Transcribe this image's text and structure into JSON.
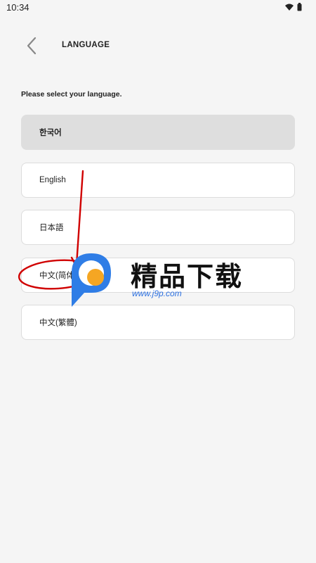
{
  "status_bar": {
    "time": "10:34"
  },
  "header": {
    "title": "LANGUAGE"
  },
  "prompt": "Please select your language.",
  "languages": [
    {
      "label": "한국어",
      "selected": true
    },
    {
      "label": "English",
      "selected": false
    },
    {
      "label": "日本語",
      "selected": false
    },
    {
      "label": "中文(简体)",
      "selected": false
    },
    {
      "label": "中文(繁體)",
      "selected": false
    }
  ],
  "watermark": {
    "text": "精品下载",
    "url": "www.j9p.com"
  },
  "icons": [
    "wifi-icon",
    "battery-icon",
    "back-arrow-icon"
  ],
  "colors": {
    "background": "#f5f5f5",
    "selected": "#dedede",
    "annotation": "#d00000"
  }
}
